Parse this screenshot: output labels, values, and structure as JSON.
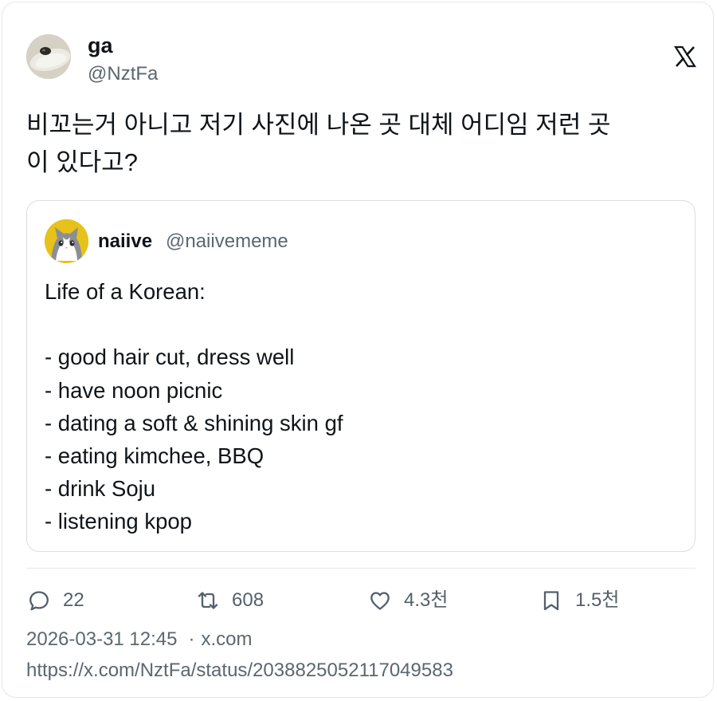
{
  "tweet": {
    "author": {
      "name": "ga",
      "handle": "@NztFa",
      "avatar_icon": "egg-photo-avatar"
    },
    "text": "비꼬는거 아니고 저기 사진에 나온 곳 대체 어디임 저런 곳\n이 있다고?",
    "quote": {
      "name": "naiive",
      "handle": "@naiivememe",
      "avatar_icon": "cat-avatar",
      "text": "Life of a Korean:\n\n- good hair cut, dress well\n- have noon picnic\n- dating a soft & shining skin gf\n- eating kimchee, BBQ\n- drink Soju\n- listening kpop"
    },
    "stats": {
      "replies": "22",
      "reposts": "608",
      "likes": "4.3천",
      "bookmarks": "1.5천"
    },
    "timestamp": "2026-03-31 12:45",
    "separator": "·",
    "source": "x.com",
    "url": "https://x.com/NztFa/status/2038825052117049583"
  },
  "colors": {
    "text": "#0f1419",
    "secondary": "#5b6770",
    "border": "#e3e6e9",
    "quote_avatar_bg": "#e6c21b"
  }
}
